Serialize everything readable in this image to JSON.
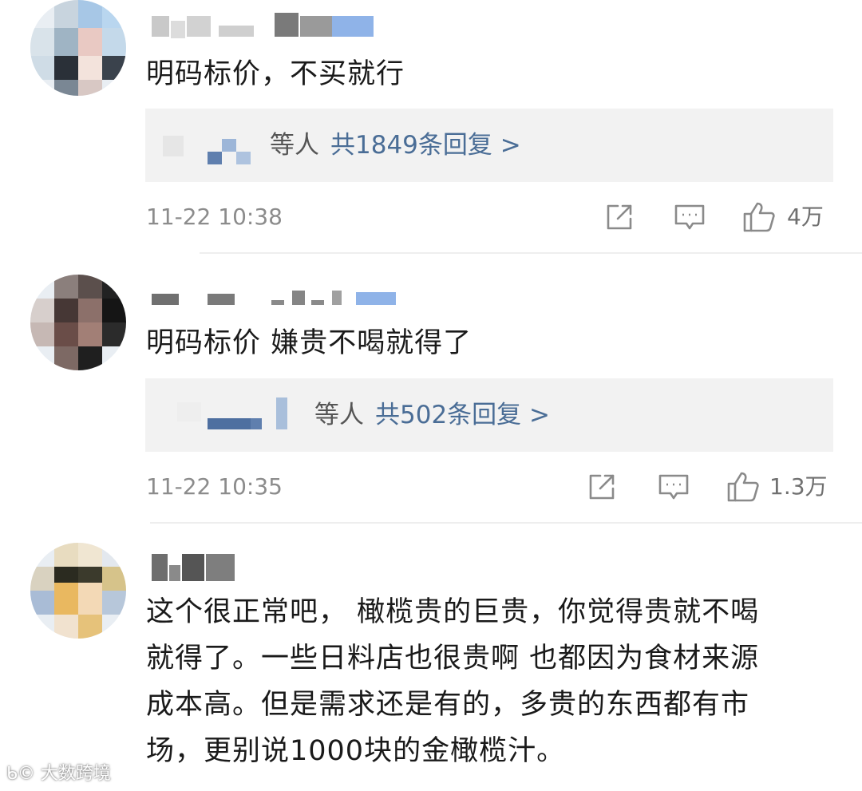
{
  "comments": [
    {
      "text": "明码标价，不买就行",
      "reply_suffix": "等人",
      "reply_count": "共1849条回复 >",
      "time": "11-22 10:38",
      "likes": "4万"
    },
    {
      "text": "明码标价 嫌贵不喝就得了",
      "reply_suffix": "等人",
      "reply_count": "共502条回复 >",
      "time": "11-22 10:35",
      "likes": "1.3万"
    },
    {
      "text_lines": [
        "这个很正常吧，  橄榄贵的巨贵，你觉得贵就不喝",
        "就得了。一些日料店也很贵啊  也都因为食材来源",
        "成本高。但是需求还是有的，多贵的东西都有市",
        "场，更别说1000块的金橄榄汁。"
      ]
    }
  ],
  "icons": {
    "share": "share-icon",
    "comment": "comment-icon",
    "like": "thumbs-up-icon"
  },
  "watermark": "大数跨境",
  "colors": {
    "link": "#4a6d96",
    "meta": "#8c8c8c",
    "reply_bg": "#f2f2f2"
  }
}
